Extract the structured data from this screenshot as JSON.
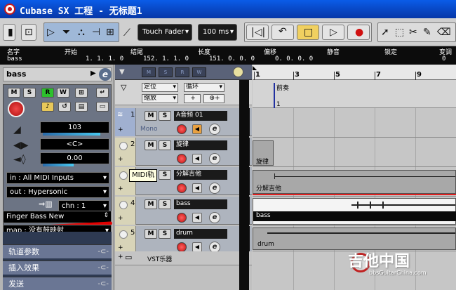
{
  "window": {
    "title": "Cubase SX 工程 - 无标题1"
  },
  "toolbar": {
    "touch_mode": "Touch Fader",
    "time_value": "100 ms"
  },
  "position_bar": {
    "headers": [
      "名字",
      "开始",
      "结尾",
      "长度",
      "偏移",
      "静音",
      "锁定",
      "变调"
    ],
    "values": [
      "bass",
      "1. 1. 1.  0",
      "152. 1. 1.  0",
      "151. 0. 0.  0",
      "0. 0. 0.  0",
      "",
      "",
      "0"
    ]
  },
  "inspector": {
    "track_name": "bass",
    "volume": "103",
    "pan": "<C>",
    "delay": "0.00",
    "input": "in : All MIDI Inputs",
    "output": "out : Hypersonic",
    "channel": "chn : 1",
    "program": "Finger Bass New",
    "map": "map : 没有鼓映射",
    "sections": [
      "轨道参数",
      "插入效果",
      "发送"
    ]
  },
  "tracklist": {
    "folder_field1": "定位",
    "folder_field2": "循环",
    "folder_field3": "缩放",
    "tracks": [
      {
        "num": "1",
        "name": "A音频 01",
        "sub": "Mono"
      },
      {
        "num": "2",
        "name": "旋律",
        "sub": ""
      },
      {
        "num": "3",
        "name": "分解吉他",
        "sub": ""
      },
      {
        "num": "4",
        "name": "bass",
        "sub": ""
      },
      {
        "num": "5",
        "name": "drum",
        "sub": ""
      }
    ],
    "tooltip": "MIDI轨",
    "vst_row": "VST乐器"
  },
  "arrange": {
    "ruler_labels": [
      "1",
      "3",
      "5",
      "7",
      "9"
    ],
    "marker_label": "前奏",
    "marker_sub": "1",
    "parts": [
      "旋律",
      "分解吉他",
      "bass",
      "drum"
    ],
    "watermark": "吉他中国",
    "watermark_url": "bbsGuitarChina.com"
  }
}
